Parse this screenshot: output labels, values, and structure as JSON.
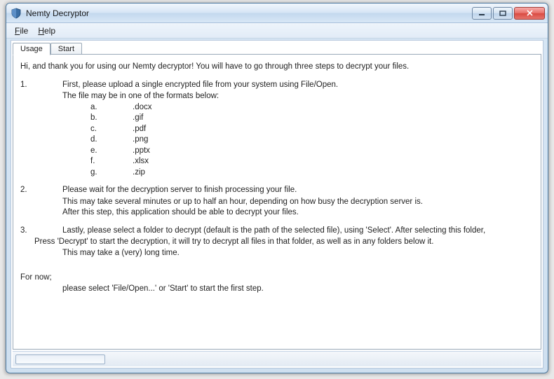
{
  "window": {
    "title": "Nemty Decryptor"
  },
  "menu": {
    "file": "File",
    "help": "Help"
  },
  "tabs": {
    "usage": "Usage",
    "start": "Start"
  },
  "content": {
    "intro": "Hi, and thank you for using our Nemty decryptor! You will have to go through three steps to decrypt your files.",
    "step1_num": "1.",
    "step1_l1": "First, please upload a single encrypted file from your system using File/Open.",
    "step1_l2": "The file may be in one of the formats below:",
    "formats": [
      {
        "letter": "a.",
        "ext": ".docx"
      },
      {
        "letter": "b.",
        "ext": ".gif"
      },
      {
        "letter": "c.",
        "ext": ".pdf"
      },
      {
        "letter": "d.",
        "ext": ".png"
      },
      {
        "letter": "e.",
        "ext": ".pptx"
      },
      {
        "letter": "f.",
        "ext": ".xlsx"
      },
      {
        "letter": "g.",
        "ext": ".zip"
      }
    ],
    "step2_num": "2.",
    "step2_l1": "Please wait for the decryption server to finish processing your file.",
    "step2_l2": "This may take several minutes or up to half an hour, depending on how busy the decryption server is.",
    "step2_l3": "After this step, this application should be able to decrypt your files.",
    "step3_num": "3.",
    "step3_l1": "Lastly, please select a folder to decrypt (default is the path of the selected file), using 'Select'. After selecting this folder,",
    "step3_l2": "Press 'Decrypt' to start the decryption, it will try to decrypt all files in that folder, as well as in any folders below it.",
    "step3_l3": "This may take a (very) long time.",
    "fornow_label": "For now;",
    "fornow_body": "please select 'File/Open...' or 'Start' to start the first step."
  }
}
